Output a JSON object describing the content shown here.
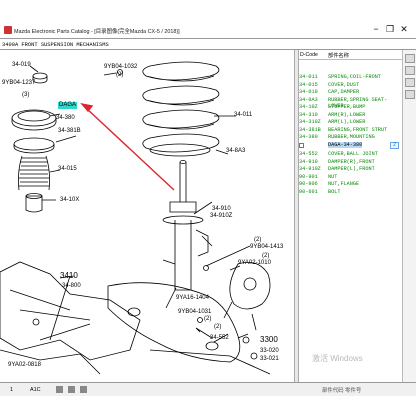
{
  "window": {
    "title": "Mazda Electronic Parts Catalog - [目录图像(完全Mazda CX-5 / 2018)]",
    "minimize": "−",
    "restore": "❐",
    "close": "✕"
  },
  "figure": {
    "title": "3400A  FRONT SUSPENSION MECHANISMS"
  },
  "diagram_labels": {
    "l1": "34-019",
    "l2": "9YB04-1032",
    "l3": "(2)",
    "l4": "9YB04-1237",
    "l5": "(3)",
    "l6": "DAGA",
    "l7": "34-380",
    "l8": "34-381B",
    "l9": "34-015",
    "l10": "34-10X",
    "l11": "34-011",
    "l12": "34-8A3",
    "l13": "34-910",
    "l14": "34-910Z",
    "l15": "(2)",
    "l16": "9YB04-1413",
    "l17": "(2)",
    "l18": "9YA02-1010",
    "l19": "3410",
    "l20": "34-800",
    "l21": "9YA16-1404",
    "l22": "9YB04-1031",
    "l23": "(2)",
    "l24": "(2)",
    "l25": "34-552",
    "l26": "3300",
    "l27": "33-020",
    "l28": "33-021",
    "l29": "9YA02-0818"
  },
  "parts_panel": {
    "col_code": "D-Code",
    "col_name": "部件名称",
    "rows": [
      {
        "code": "34-011",
        "name": "SPRING,COIL-FRONT"
      },
      {
        "code": "34-015",
        "name": "COVER,DUST"
      },
      {
        "code": "34-019",
        "name": "CAP,DAMPER"
      },
      {
        "code": "34-0A3",
        "name": "RUBBER,SPRING SEAT-LOWER"
      },
      {
        "code": "34-10Z",
        "name": "STOPPER,BUMP"
      },
      {
        "code": "34-310",
        "name": "ARM(R),LOWER"
      },
      {
        "code": "34-310Z",
        "name": "ARM(L),LOWER"
      },
      {
        "code": "34-381B",
        "name": "BEARING,FRONT STRUT"
      },
      {
        "code": "34-380",
        "name": "RUBBER,MOUNTING"
      },
      {
        "code": "",
        "name": "DAGA-34-380"
      },
      {
        "code": "34-552",
        "name": "COVER,BALL JOINT"
      },
      {
        "code": "34-910",
        "name": "DAMPER(R),FRONT"
      },
      {
        "code": "34-910Z",
        "name": "DAMPER(L),FRONT"
      },
      {
        "code": "90-901",
        "name": "NUT"
      },
      {
        "code": "90-906",
        "name": "NUT,FLANGE"
      },
      {
        "code": "90-601",
        "name": "BOLT"
      }
    ],
    "qty": "2"
  },
  "status_bar": {
    "s1": "1",
    "s2": "A1C",
    "right": "部件代码 零件号"
  },
  "watermark": "激活 Windows",
  "colors": {
    "part_text": "#0b8a0b",
    "highlight": "#30d7cd",
    "arrow": "#e0252b"
  }
}
